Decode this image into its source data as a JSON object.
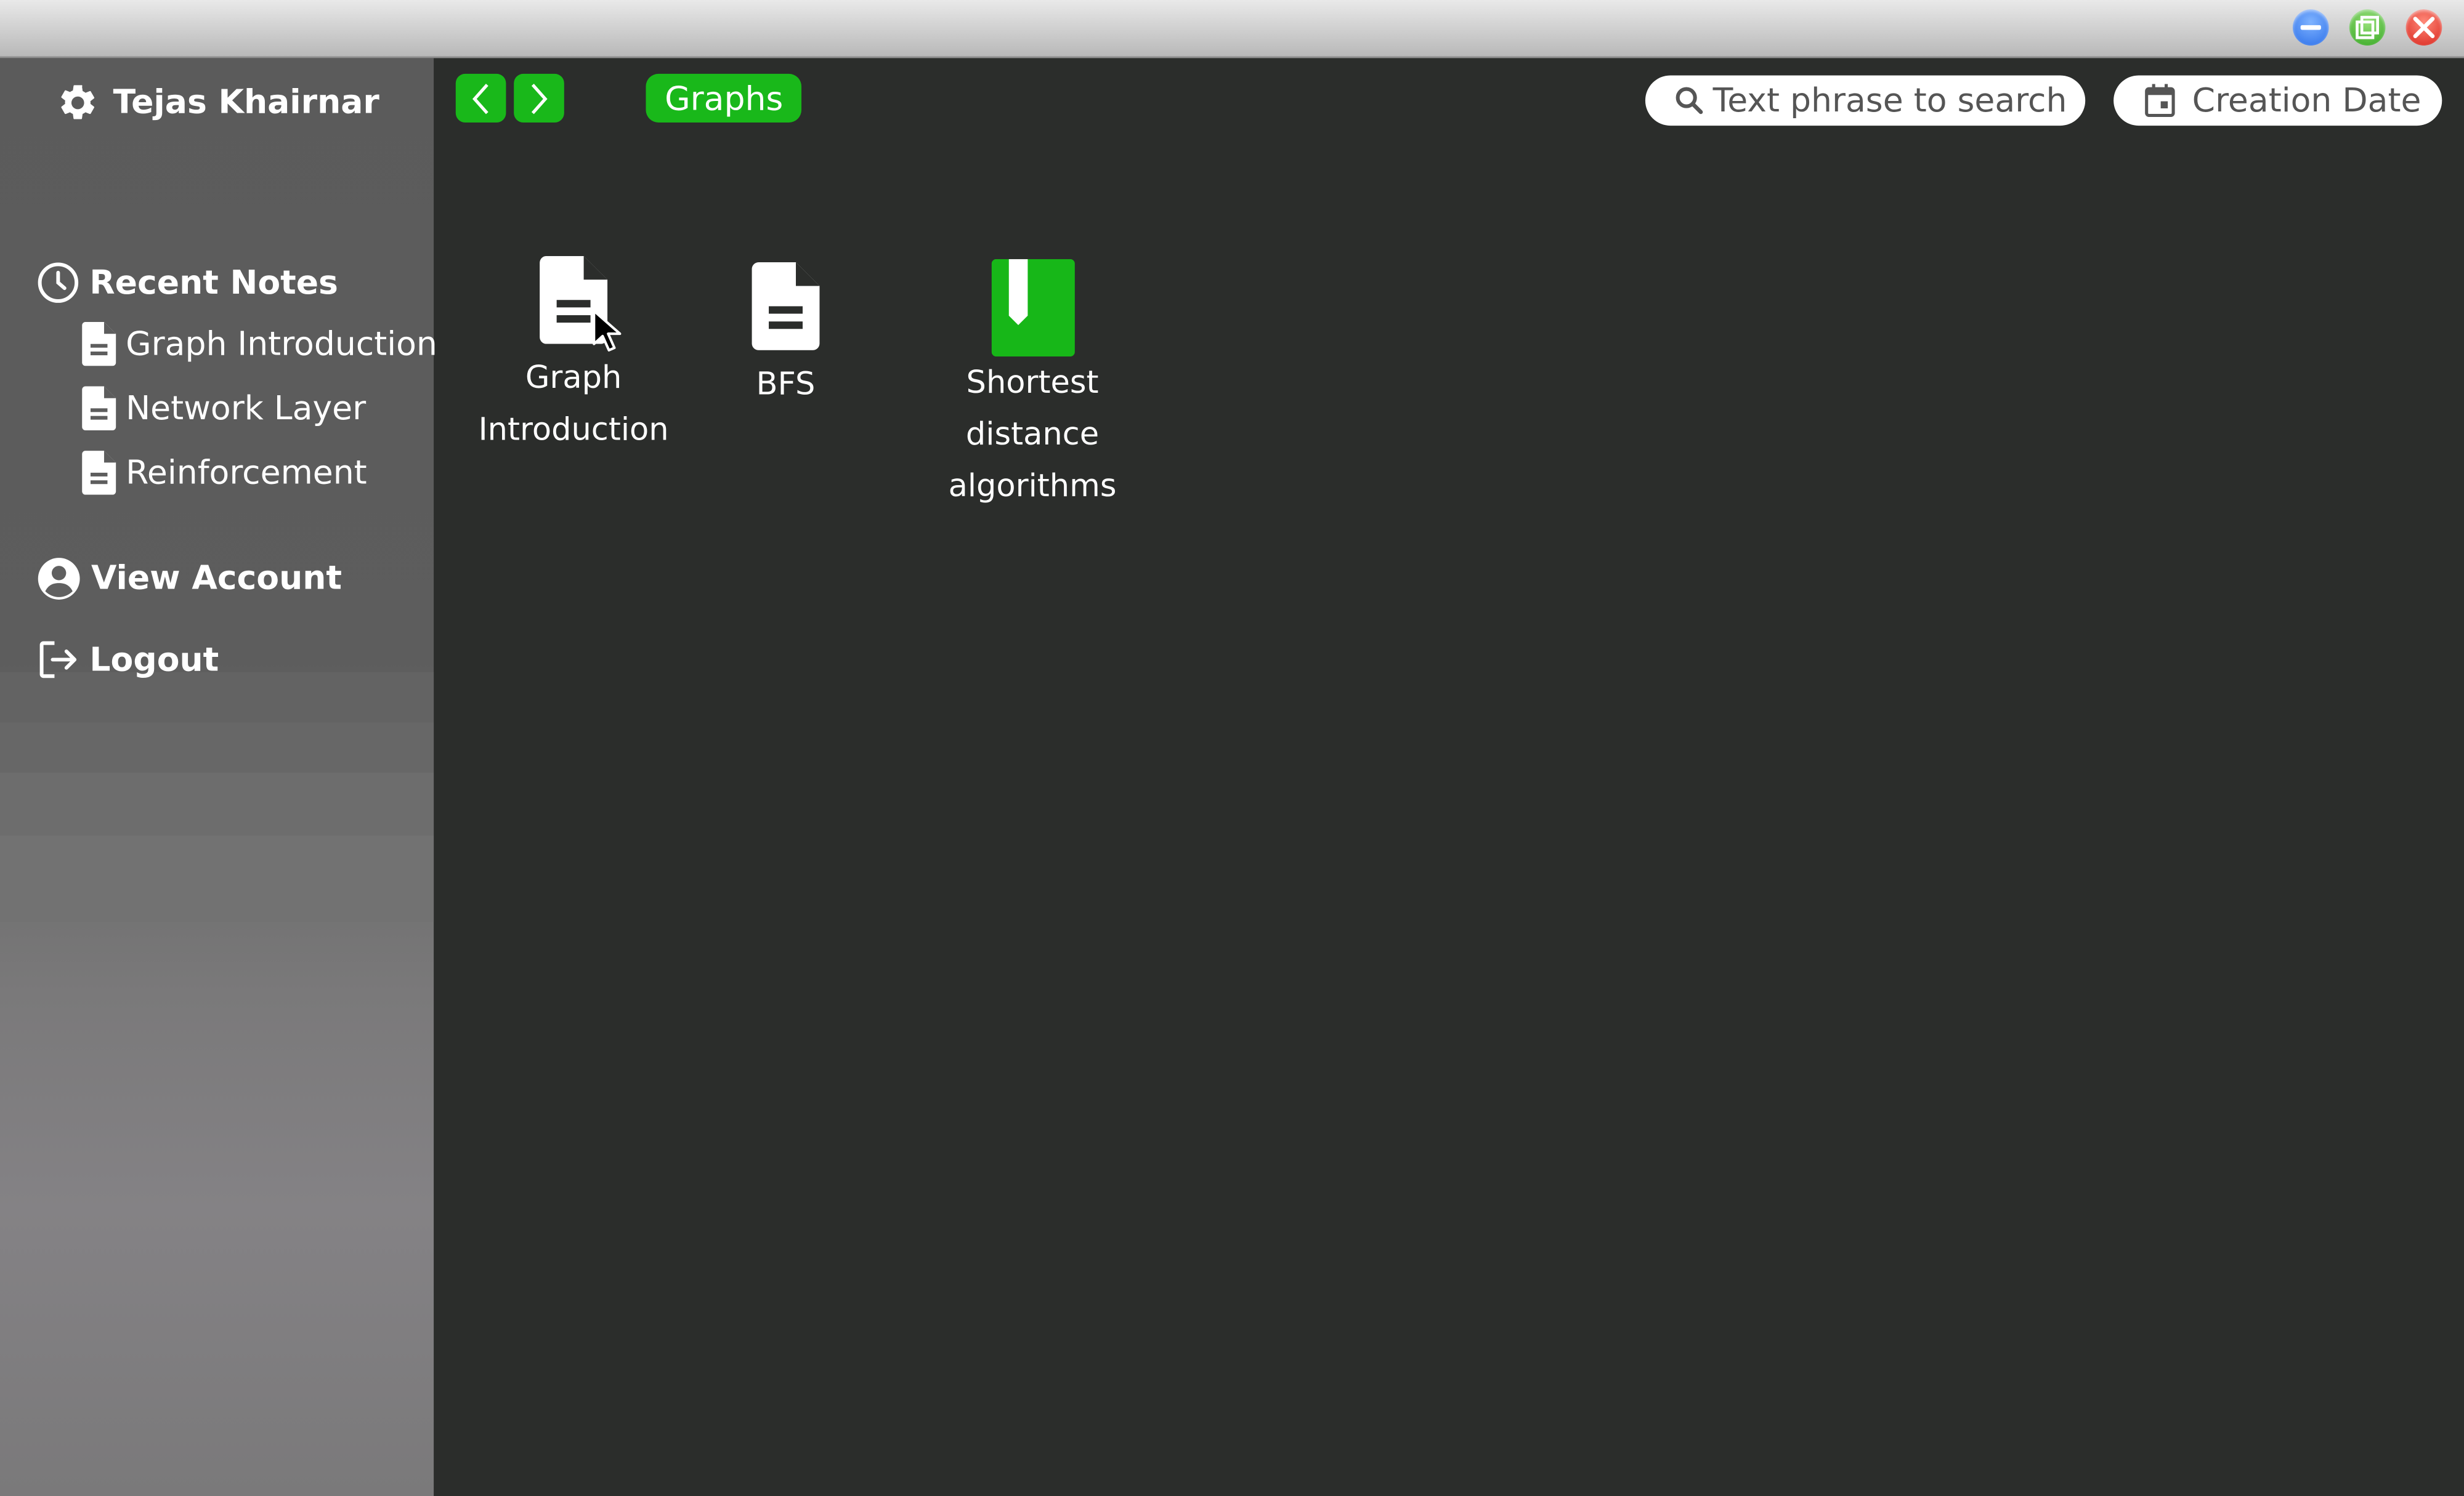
{
  "window": {
    "controls": {
      "minimize_icon": "minimize-icon",
      "maximize_icon": "maximize-icon",
      "close_icon": "close-icon"
    }
  },
  "sidebar": {
    "user_name": "Tejas Khairnar",
    "settings_icon": "gear-icon",
    "recent_notes": {
      "heading": "Recent Notes",
      "icon": "clock-icon",
      "items": [
        {
          "label": "Graph Introduction",
          "icon": "document-icon"
        },
        {
          "label": "Network Layer",
          "icon": "document-icon"
        },
        {
          "label": "Reinforcement",
          "icon": "document-icon"
        }
      ]
    },
    "view_account": {
      "label": "View Account",
      "icon": "account-circle-icon"
    },
    "logout": {
      "label": "Logout",
      "icon": "logout-icon"
    }
  },
  "toolbar": {
    "back_icon": "chevron-left-icon",
    "forward_icon": "chevron-right-icon",
    "breadcrumb": "Graphs",
    "search": {
      "placeholder": "Text phrase to search",
      "icon": "search-icon"
    },
    "date_filter": {
      "label": "Creation Date",
      "icon": "calendar-icon"
    }
  },
  "files": [
    {
      "label_line1": "Graph",
      "label_line2": "Introduction",
      "type": "note",
      "icon": "document-icon"
    },
    {
      "label_line1": "BFS",
      "type": "note",
      "icon": "document-icon"
    },
    {
      "label_line1": "Shortest",
      "label_line2": "distance",
      "label_line3": "algorithms",
      "type": "notebook",
      "icon": "notebook-icon"
    }
  ],
  "colors": {
    "accent": "#19b81a",
    "background": "#2b2d2b",
    "sidebar": "#5d5d5d"
  }
}
